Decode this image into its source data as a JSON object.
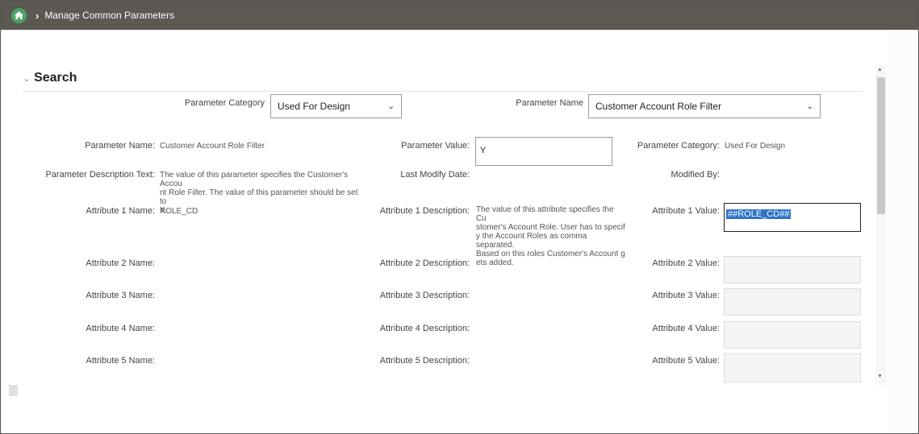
{
  "breadcrumb": {
    "home_icon": "home-icon",
    "separator": "›",
    "current": "Manage Common Parameters"
  },
  "search": {
    "title": "Search",
    "parameter_category_label": "Parameter Category",
    "parameter_category_value": "Used For Design",
    "parameter_name_label": "Parameter Name",
    "parameter_name_value": "Customer Account Role Filter"
  },
  "details": {
    "param_name_label": "Parameter Name:",
    "param_name_value": "Customer Account Role Filter",
    "param_value_label": "Parameter Value:",
    "param_value": "Y",
    "param_category_label": "Parameter Category:",
    "param_category_value": "Used For Design",
    "param_desc_label": "Parameter Description Text:",
    "param_desc_lines": [
      "The value of this parameter specifies the Customer's Accou",
      "nt Role Filter. The value of this parameter should be set to",
      "Y."
    ],
    "last_modify_label": "Last Modify Date:",
    "modified_by_label": "Modified By:",
    "attr1_name_label": "Attribute 1 Name:",
    "attr1_name_value": "ROLE_CD",
    "attr1_desc_label": "Attribute 1 Description:",
    "attr1_desc_lines": [
      "The value of this attribute specifies the Cu",
      "stomer's Account Role. User has to specif",
      "y the Account Roles as comma separated.",
      "Based on this roles Customer's Account g",
      "ets added."
    ],
    "attr1_value_label": "Attribute 1 Value:",
    "attr1_value": "##ROLE_CD##",
    "attr2_name_label": "Attribute 2 Name:",
    "attr2_desc_label": "Attribute 2 Description:",
    "attr2_value_label": "Attribute 2 Value:",
    "attr3_name_label": "Attribute 3 Name:",
    "attr3_desc_label": "Attribute 3 Description:",
    "attr3_value_label": "Attribute 3 Value:",
    "attr4_name_label": "Attribute 4 Name:",
    "attr4_desc_label": "Attribute 4 Description:",
    "attr4_value_label": "Attribute 4 Value:",
    "attr5_name_label": "Attribute 5 Name:",
    "attr5_desc_label": "Attribute 5 Description:",
    "attr5_value_label": "Attribute 5 Value:"
  },
  "colors": {
    "topbar": "#5c5852",
    "home": "#4aa564",
    "selection": "#2e73c8"
  }
}
